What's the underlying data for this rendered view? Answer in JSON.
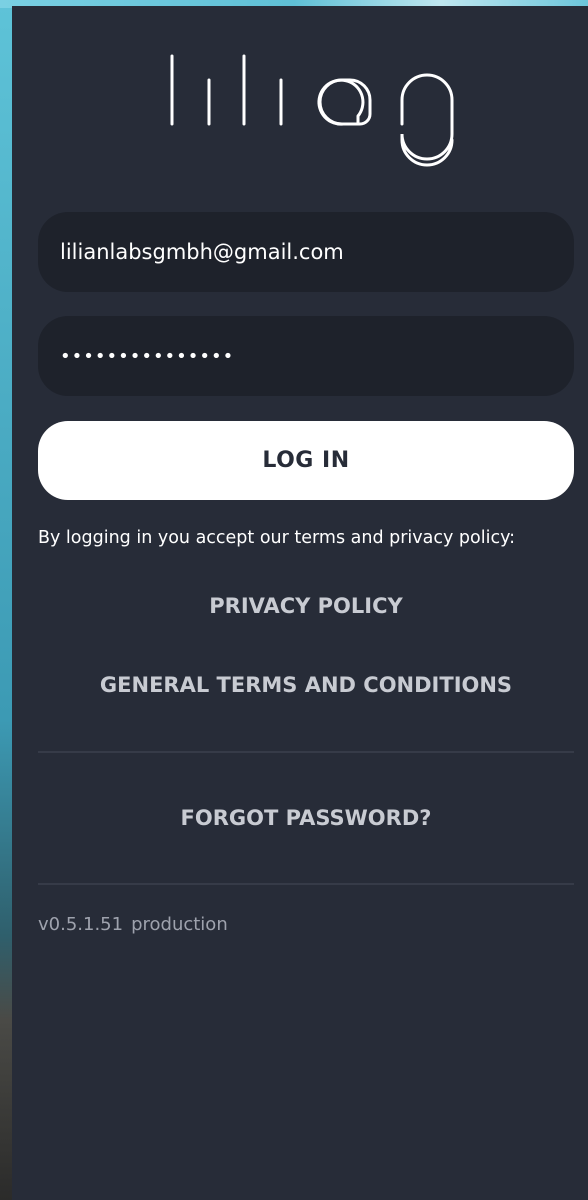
{
  "app": {
    "logo_text": "lilian"
  },
  "login_form": {
    "email_value": "lilianlabsgmbh@gmail.com",
    "password_value": "•••••••••••••••",
    "login_button_label": "LOG IN"
  },
  "legal": {
    "consent_text": "By logging in you accept our terms and privacy policy:",
    "privacy_policy_label": "PRIVACY POLICY",
    "terms_label": "GENERAL TERMS AND CONDITIONS"
  },
  "forgot_password_label": "FORGOT PASSWORD?",
  "footer": {
    "version": "v0.5.1.51",
    "environment": "production"
  },
  "colors": {
    "panel_background": "#272c38",
    "field_background": "#1e222b",
    "button_background": "#ffffff",
    "link_text": "#c8cbd2",
    "divider": "#363b48"
  }
}
